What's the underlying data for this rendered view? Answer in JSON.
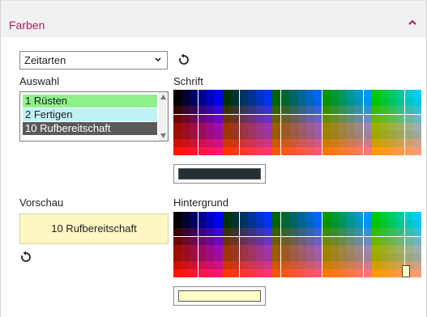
{
  "panel": {
    "title": "Farben",
    "collapse_icon": "chevron-up-icon",
    "accent_color": "#b0195e"
  },
  "type_select": {
    "value": "Zeitarten",
    "icon": "chevron-down-icon"
  },
  "reset_icon": "reset-icon",
  "auswahl": {
    "label": "Auswahl",
    "items": [
      {
        "label": "1 Rüsten",
        "background": "#8ff08b",
        "color": "#222222"
      },
      {
        "label": "2 Fertigen",
        "background": "#bff2f6",
        "color": "#222222"
      },
      {
        "label": "10 Rufbereitschaft",
        "background": "#5a5a5a",
        "color": "#ffffff"
      }
    ]
  },
  "schrift": {
    "label": "Schrift",
    "selected_color": "#253036"
  },
  "vorschau": {
    "label": "Vorschau",
    "text": "10 Rufbereitschaft",
    "background": "#fff7c3"
  },
  "hintergrund": {
    "label": "Hintergrund",
    "selected_color": "#fffdc8"
  }
}
